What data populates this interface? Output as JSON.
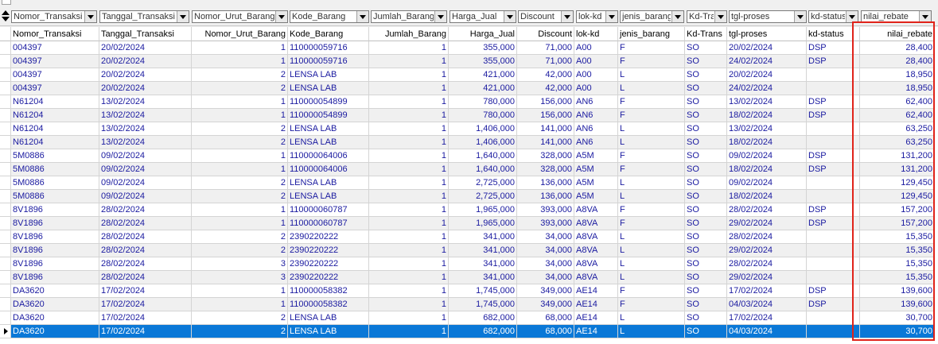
{
  "filters": [
    {
      "label": "Nomor_Transaksi"
    },
    {
      "label": "Tanggal_Transaksi"
    },
    {
      "label": "Nomor_Urut_Barang"
    },
    {
      "label": "Kode_Barang"
    },
    {
      "label": "Jumlah_Barang"
    },
    {
      "label": "Harga_Jual"
    },
    {
      "label": "Discount"
    },
    {
      "label": "lok-kd"
    },
    {
      "label": "jenis_barang"
    },
    {
      "label": "Kd-Trans"
    },
    {
      "label": "tgl-proses"
    },
    {
      "label": "kd-status"
    },
    {
      "label": "nilai_rebate"
    }
  ],
  "columns": [
    "Nomor_Transaksi",
    "Tanggal_Transaksi",
    "Nomor_Urut_Barang",
    "Kode_Barang",
    "Jumlah_Barang",
    "Harga_Jual",
    "Discount",
    "lok-kd",
    "jenis_barang",
    "Kd-Trans",
    "tgl-proses",
    "kd-status",
    "nilai_rebate"
  ],
  "rows": [
    [
      "004397",
      "20/02/2024",
      "1",
      "110000059716",
      "1",
      "355,000",
      "71,000",
      "A00",
      "F",
      "SO",
      "20/02/2024",
      "DSP",
      "28,400"
    ],
    [
      "004397",
      "20/02/2024",
      "1",
      "110000059716",
      "1",
      "355,000",
      "71,000",
      "A00",
      "F",
      "SO",
      "24/02/2024",
      "DSP",
      "28,400"
    ],
    [
      "004397",
      "20/02/2024",
      "2",
      "LENSA LAB",
      "1",
      "421,000",
      "42,000",
      "A00",
      "L",
      "SO",
      "20/02/2024",
      "",
      "18,950"
    ],
    [
      "004397",
      "20/02/2024",
      "2",
      "LENSA LAB",
      "1",
      "421,000",
      "42,000",
      "A00",
      "L",
      "SO",
      "24/02/2024",
      "",
      "18,950"
    ],
    [
      "N61204",
      "13/02/2024",
      "1",
      "110000054899",
      "1",
      "780,000",
      "156,000",
      "AN6",
      "F",
      "SO",
      "13/02/2024",
      "DSP",
      "62,400"
    ],
    [
      "N61204",
      "13/02/2024",
      "1",
      "110000054899",
      "1",
      "780,000",
      "156,000",
      "AN6",
      "F",
      "SO",
      "18/02/2024",
      "DSP",
      "62,400"
    ],
    [
      "N61204",
      "13/02/2024",
      "2",
      "LENSA LAB",
      "1",
      "1,406,000",
      "141,000",
      "AN6",
      "L",
      "SO",
      "13/02/2024",
      "",
      "63,250"
    ],
    [
      "N61204",
      "13/02/2024",
      "2",
      "LENSA LAB",
      "1",
      "1,406,000",
      "141,000",
      "AN6",
      "L",
      "SO",
      "18/02/2024",
      "",
      "63,250"
    ],
    [
      "5M0886",
      "09/02/2024",
      "1",
      "110000064006",
      "1",
      "1,640,000",
      "328,000",
      "A5M",
      "F",
      "SO",
      "09/02/2024",
      "DSP",
      "131,200"
    ],
    [
      "5M0886",
      "09/02/2024",
      "1",
      "110000064006",
      "1",
      "1,640,000",
      "328,000",
      "A5M",
      "F",
      "SO",
      "18/02/2024",
      "DSP",
      "131,200"
    ],
    [
      "5M0886",
      "09/02/2024",
      "2",
      "LENSA LAB",
      "1",
      "2,725,000",
      "136,000",
      "A5M",
      "L",
      "SO",
      "09/02/2024",
      "",
      "129,450"
    ],
    [
      "5M0886",
      "09/02/2024",
      "2",
      "LENSA LAB",
      "1",
      "2,725,000",
      "136,000",
      "A5M",
      "L",
      "SO",
      "18/02/2024",
      "",
      "129,450"
    ],
    [
      "8V1896",
      "28/02/2024",
      "1",
      "110000060787",
      "1",
      "1,965,000",
      "393,000",
      "A8VA",
      "F",
      "SO",
      "28/02/2024",
      "DSP",
      "157,200"
    ],
    [
      "8V1896",
      "28/02/2024",
      "1",
      "110000060787",
      "1",
      "1,965,000",
      "393,000",
      "A8VA",
      "F",
      "SO",
      "29/02/2024",
      "DSP",
      "157,200"
    ],
    [
      "8V1896",
      "28/02/2024",
      "2",
      "2390220222",
      "1",
      "341,000",
      "34,000",
      "A8VA",
      "L",
      "SO",
      "28/02/2024",
      "",
      "15,350"
    ],
    [
      "8V1896",
      "28/02/2024",
      "2",
      "2390220222",
      "1",
      "341,000",
      "34,000",
      "A8VA",
      "L",
      "SO",
      "29/02/2024",
      "",
      "15,350"
    ],
    [
      "8V1896",
      "28/02/2024",
      "3",
      "2390220222",
      "1",
      "341,000",
      "34,000",
      "A8VA",
      "L",
      "SO",
      "28/02/2024",
      "",
      "15,350"
    ],
    [
      "8V1896",
      "28/02/2024",
      "3",
      "2390220222",
      "1",
      "341,000",
      "34,000",
      "A8VA",
      "L",
      "SO",
      "29/02/2024",
      "",
      "15,350"
    ],
    [
      "DA3620",
      "17/02/2024",
      "1",
      "110000058382",
      "1",
      "1,745,000",
      "349,000",
      "AE14",
      "F",
      "SO",
      "17/02/2024",
      "DSP",
      "139,600"
    ],
    [
      "DA3620",
      "17/02/2024",
      "1",
      "110000058382",
      "1",
      "1,745,000",
      "349,000",
      "AE14",
      "F",
      "SO",
      "04/03/2024",
      "DSP",
      "139,600"
    ],
    [
      "DA3620",
      "17/02/2024",
      "2",
      "LENSA LAB",
      "1",
      "682,000",
      "68,000",
      "AE14",
      "L",
      "SO",
      "17/02/2024",
      "",
      "30,700"
    ],
    [
      "DA3620",
      "17/02/2024",
      "2",
      "LENSA LAB",
      "1",
      "682,000",
      "68,000",
      "AE14",
      "L",
      "SO",
      "04/03/2024",
      "",
      "30,700"
    ]
  ],
  "selected_row": 21,
  "highlight_color": "#e0231a",
  "selection_color": "#0a78d7"
}
